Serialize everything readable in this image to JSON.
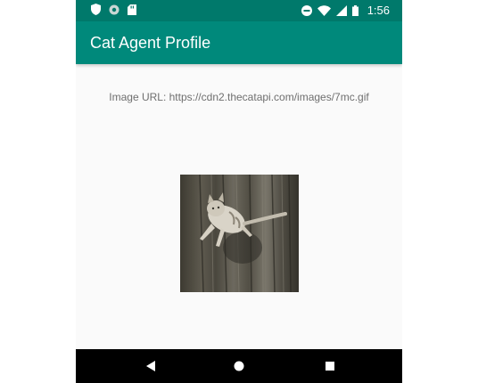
{
  "status_bar": {
    "time": "1:56",
    "left_icons": [
      "shield-icon",
      "settings-circle-icon",
      "sd-card-icon"
    ],
    "right_icons": [
      "do-not-disturb-icon",
      "wifi-icon",
      "signal-icon",
      "battery-icon"
    ]
  },
  "app_bar": {
    "title": "Cat Agent Profile"
  },
  "content": {
    "image_url_text": "Image URL: https://cdn2.thecatapi.com/images/7mc.gif",
    "image_subject": "cat photo"
  },
  "nav_bar": {
    "buttons": [
      "back",
      "home",
      "recents"
    ]
  },
  "colors": {
    "status_bar": "#00796b",
    "app_bar": "#00897b",
    "background": "#fafafa",
    "text_secondary": "#6f6f6f",
    "nav_bar": "#000000"
  }
}
